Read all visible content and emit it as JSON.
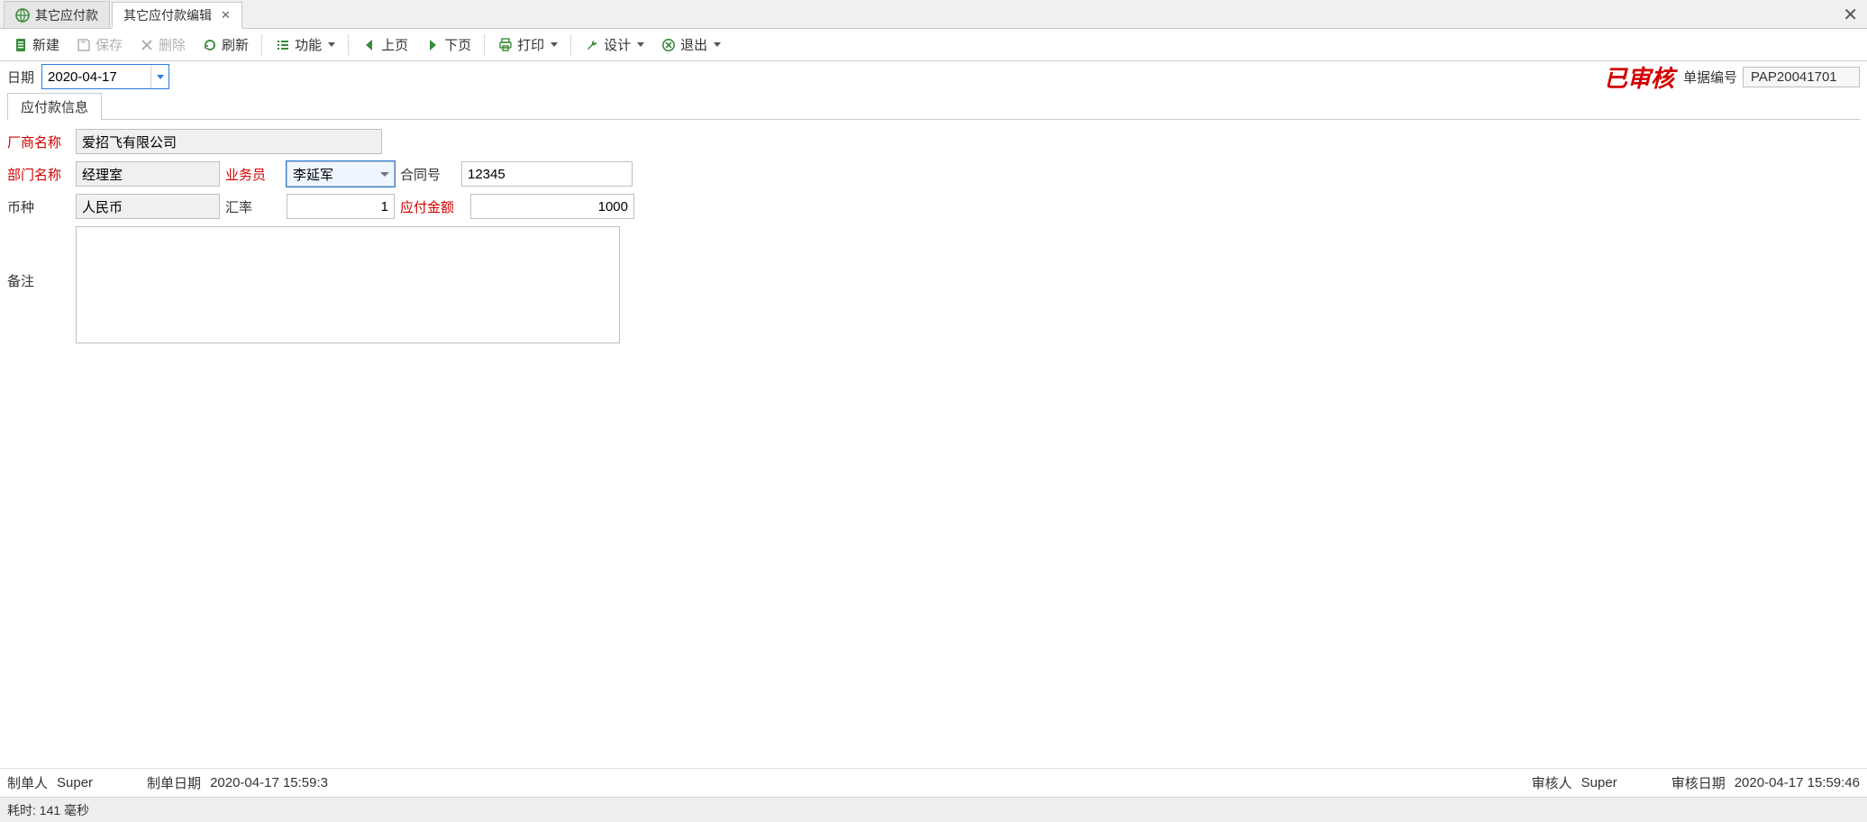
{
  "tabs": [
    {
      "label": "其它应付款",
      "closable": false
    },
    {
      "label": "其它应付款编辑",
      "closable": true
    }
  ],
  "active_tab_index": 1,
  "toolbar": {
    "new_label": "新建",
    "save_label": "保存",
    "delete_label": "删除",
    "refresh_label": "刷新",
    "function_label": "功能",
    "prev_label": "上页",
    "next_label": "下页",
    "print_label": "打印",
    "design_label": "设计",
    "exit_label": "退出"
  },
  "header": {
    "date_label": "日期",
    "date_value": "2020-04-17",
    "approved_stamp": "已审核",
    "docno_label": "单据编号",
    "docno_value": "PAP20041701"
  },
  "section": {
    "tab_label": "应付款信息",
    "vendor_label": "厂商名称",
    "vendor_value": "爱招飞有限公司",
    "dept_label": "部门名称",
    "dept_value": "经理室",
    "clerk_label": "业务员",
    "clerk_value": "李延军",
    "contract_label": "合同号",
    "contract_value": "12345",
    "currency_label": "币种",
    "currency_value": "人民币",
    "rate_label": "汇率",
    "rate_value": "1",
    "payable_label": "应付金额",
    "payable_value": "1000",
    "remarks_label": "备注",
    "remarks_value": ""
  },
  "footer": {
    "creator_label": "制单人",
    "creator_value": "Super",
    "create_date_label": "制单日期",
    "create_date_value": "2020-04-17 15:59:3",
    "approver_label": "审核人",
    "approver_value": "Super",
    "approve_date_label": "审核日期",
    "approve_date_value": "2020-04-17 15:59:46"
  },
  "status": {
    "elapsed_label": "耗时: 141 毫秒"
  }
}
